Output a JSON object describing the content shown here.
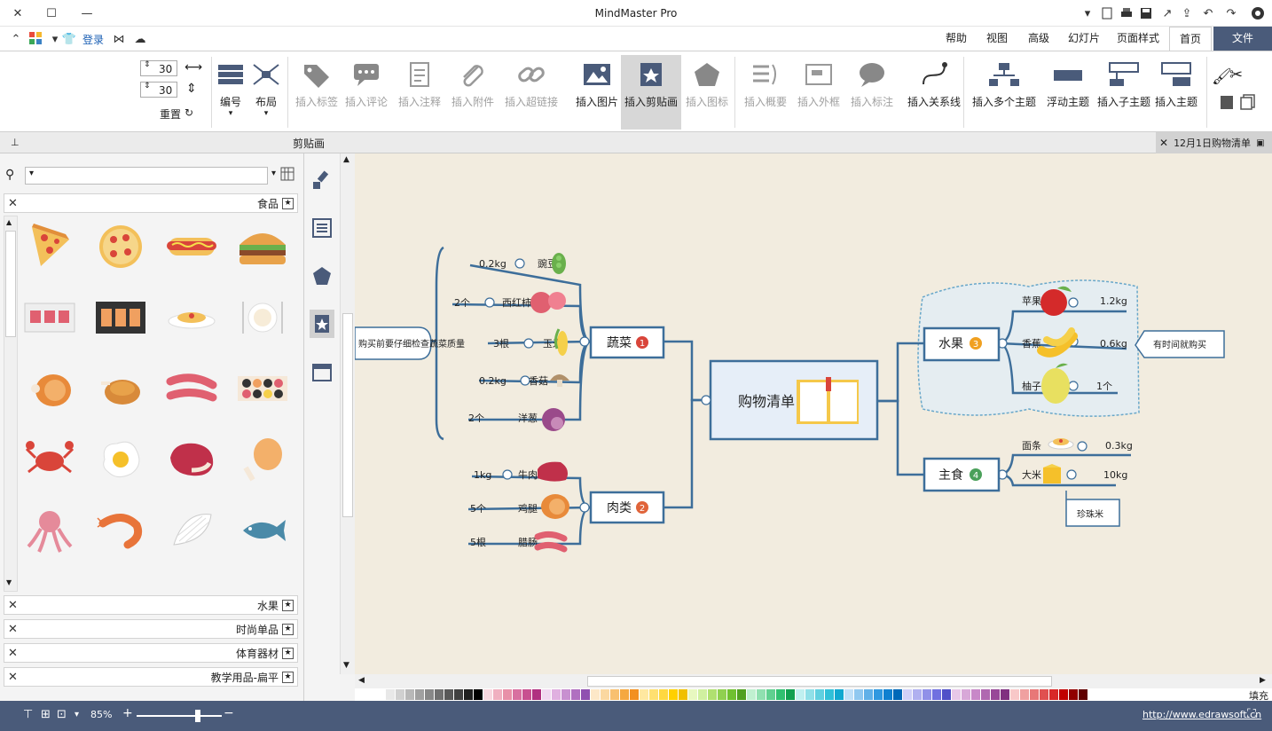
{
  "app": {
    "title": "MindMaster Pro"
  },
  "quick_access": {
    "login_label": "登录"
  },
  "tabs": [
    {
      "label": "文件"
    },
    {
      "label": "首页"
    },
    {
      "label": "页面样式"
    },
    {
      "label": "幻灯片"
    },
    {
      "label": "高级"
    },
    {
      "label": "视图"
    },
    {
      "label": "帮助"
    }
  ],
  "ribbon": {
    "insert_topic": "插入主题",
    "insert_subtopic": "插入子主题",
    "floating_topic": "浮动主题",
    "insert_multiple": "插入多个主题",
    "insert_relationship": "插入关系线",
    "insert_callout": "插入标注",
    "insert_boundary": "插入外框",
    "insert_summary": "插入概要",
    "insert_icon": "插入图标",
    "insert_clipart": "插入剪贴画",
    "insert_image": "插入图片",
    "insert_hyperlink": "插入超链接",
    "insert_attachment": "插入附件",
    "insert_note": "插入注释",
    "insert_comment": "插入评论",
    "insert_tag": "插入标签",
    "layout": "布局",
    "numbering": "编号",
    "spacing_h": "30",
    "spacing_v": "30",
    "reset": "重置"
  },
  "doc_tab": {
    "title": "12月1日购物清单"
  },
  "panel": {
    "title": "剪贴画",
    "search_placeholder": "",
    "categories_open": "食品",
    "categories": [
      "水果",
      "时尚单品",
      "体育器材",
      "教学用品-扁平"
    ]
  },
  "mindmap": {
    "central": "购物清单",
    "branches": [
      {
        "num": "1",
        "label": "蔬菜",
        "color": "#d9453a",
        "children": [
          {
            "name": "豌豆",
            "qty": "0.2kg"
          },
          {
            "name": "西红柿",
            "qty": "2个"
          },
          {
            "name": "玉米",
            "qty": "3根"
          },
          {
            "name": "香菇",
            "qty": "0.2kg"
          },
          {
            "name": "洋葱",
            "qty": "2个"
          }
        ],
        "callout": "购买前要仔细检查蔬菜质量"
      },
      {
        "num": "2",
        "label": "肉类",
        "color": "#e0643a",
        "children": [
          {
            "name": "牛肉",
            "qty": "1kg"
          },
          {
            "name": "鸡腿",
            "qty": "5个"
          },
          {
            "name": "腊肠",
            "qty": "5根"
          }
        ]
      },
      {
        "num": "3",
        "label": "水果",
        "color": "#f0a020",
        "children": [
          {
            "name": "苹果",
            "qty": "1.2kg"
          },
          {
            "name": "香蕉",
            "qty": "0.6kg"
          },
          {
            "name": "柚子",
            "qty": "1个"
          }
        ],
        "callout": "有时间就购买"
      },
      {
        "num": "4",
        "label": "主食",
        "color": "#4aa05a",
        "children": [
          {
            "name": "面条",
            "qty": "0.3kg"
          },
          {
            "name": "大米",
            "qty": "10kg"
          }
        ],
        "callout": "珍珠米"
      }
    ]
  },
  "palette_label": "填充",
  "status": {
    "zoom": "85%",
    "website": "http://www.edrawsoft.cn"
  },
  "colors": {
    "accent": "#4a5b7a",
    "branch_line": "#3d6e9a",
    "canvas": "#f2ecdf"
  }
}
